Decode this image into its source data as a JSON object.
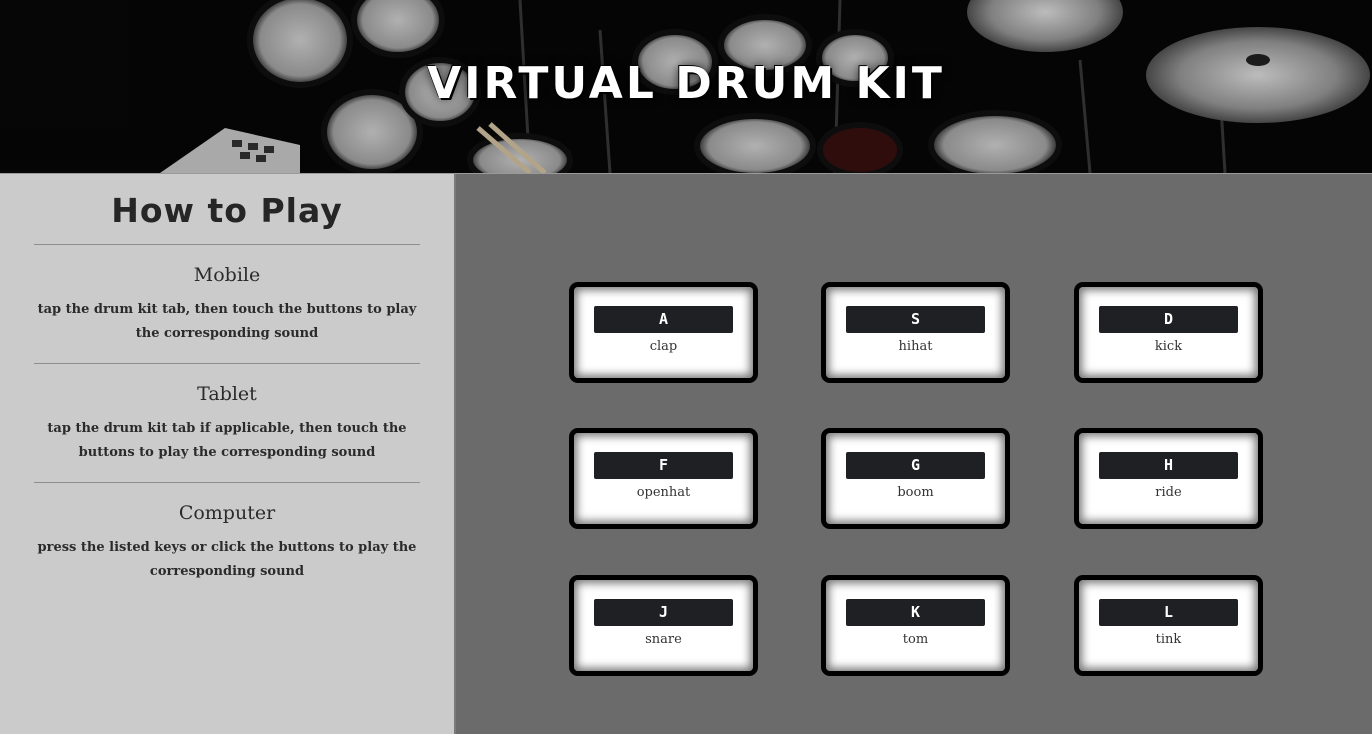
{
  "header": {
    "title": "VIRTUAL DRUM KIT"
  },
  "sidebar": {
    "title": "How to Play",
    "sections": [
      {
        "heading": "Mobile",
        "text": "tap the drum kit tab, then touch the buttons to play the corresponding sound"
      },
      {
        "heading": "Tablet",
        "text": "tap the drum kit tab if applicable, then touch the buttons to play the corresponding sound"
      },
      {
        "heading": "Computer",
        "text": "press the listed keys or click the buttons to play the corresponding sound"
      }
    ]
  },
  "pads": [
    {
      "key": "A",
      "sound": "clap"
    },
    {
      "key": "S",
      "sound": "hihat"
    },
    {
      "key": "D",
      "sound": "kick"
    },
    {
      "key": "F",
      "sound": "openhat"
    },
    {
      "key": "G",
      "sound": "boom"
    },
    {
      "key": "H",
      "sound": "ride"
    },
    {
      "key": "J",
      "sound": "snare"
    },
    {
      "key": "K",
      "sound": "tom"
    },
    {
      "key": "L",
      "sound": "tink"
    }
  ],
  "colors": {
    "page_background": "#6b6b6b",
    "sidebar_background": "#cbcbcb",
    "key_label_background": "#1e2023",
    "pad_border": "#000000"
  }
}
